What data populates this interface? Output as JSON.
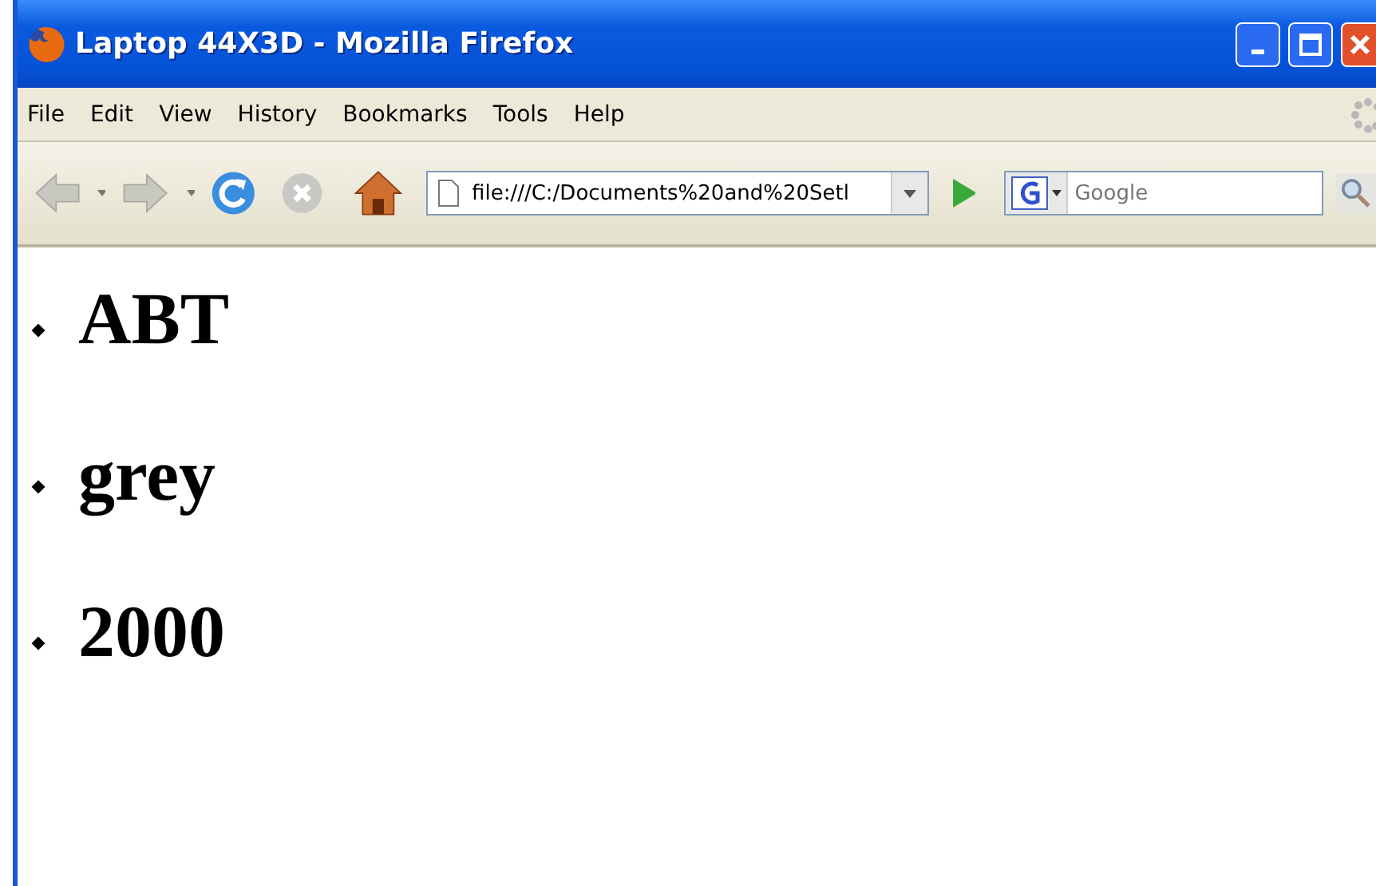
{
  "window": {
    "title": "Laptop 44X3D - Mozilla Firefox"
  },
  "menu": [
    "File",
    "Edit",
    "View",
    "History",
    "Bookmarks",
    "Tools",
    "Help"
  ],
  "address_bar": {
    "value": "file:///C:/Documents%20and%20Setl"
  },
  "search": {
    "placeholder": "Google"
  },
  "list": [
    "ABT",
    "grey",
    "2000"
  ]
}
